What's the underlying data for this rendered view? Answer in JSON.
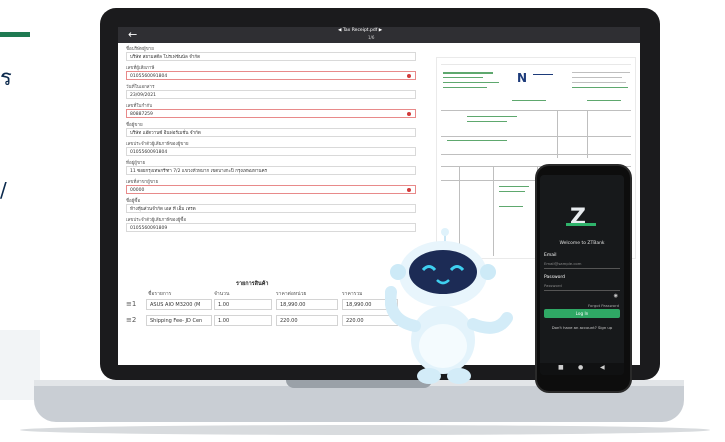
{
  "hero": {
    "accent_color": "#1f7a52",
    "clipped_glyph_1": "ร",
    "clipped_glyph_2": "/"
  },
  "app": {
    "doc_title": "Tax Receipt.pdf",
    "doc_pages": "1/6",
    "fields": [
      {
        "label": "ชื่อบริษัทผู้ขาย",
        "value": "บริษัท สยามสตีล โปรเฟชันนัล จำกัด",
        "error": false
      },
      {
        "label": "เลขที่ผู้เสียภาษี",
        "value": "0105560091804",
        "error": true
      },
      {
        "label": "วันที่ในเอกสาร",
        "value": "23/09/2021",
        "error": false
      },
      {
        "label": "เลขที่ใบกำกับ",
        "value": "80887259",
        "error": true
      },
      {
        "label": "ชื่อผู้ขาย",
        "value": "บริษัท แอ๊ดวานซ์ อินฟอร์เมชั่น จำกัด",
        "error": false
      },
      {
        "label": "เลขประจำตัวผู้เสียภาษีของผู้ขาย",
        "value": "0105560091804",
        "error": false
      },
      {
        "label": "ที่อยู่ผู้ขาย",
        "value": "11 ซอยกรุงเทพกรีฑา 7/2 แขวงหัวหมาก เขตบางกะปิ กรุงเทพมหานคร",
        "error": false
      },
      {
        "label": "เลขที่สาขาผู้ขาย",
        "value": "00000",
        "error": true
      },
      {
        "label": "ชื่อผู้ซื้อ",
        "value": "ห้างหุ้นส่วนจำกัด เอส ที เอ็ม เทรด",
        "error": false
      },
      {
        "label": "เลขประจำตัวผู้เสียภาษีของผู้ซื้อ",
        "value": "0105560091809",
        "error": false
      }
    ],
    "items_title": "รายการสินค้า",
    "table_headers": [
      "ชื่อรายการ",
      "จำนวน",
      "ราคาต่อหน่วย",
      "ราคารวม"
    ],
    "rows": [
      {
        "index": "1",
        "name": "ASUS AIO M3200 (M",
        "qty": "1.00",
        "unit_price": "18,990.00",
        "total": "18,990.00"
      },
      {
        "index": "2",
        "name": "Shipping Fee- JD Cen",
        "qty": "1.00",
        "unit_price": "220.00",
        "total": "220.00"
      }
    ],
    "icons": {
      "back": "back-arrow-icon",
      "prev": "prev-page-icon",
      "next": "next-page-icon",
      "error": "error-dot-icon"
    }
  },
  "phone": {
    "welcome": "Welcome to ZTBank",
    "email_label": "Email",
    "email_placeholder": "Email@sample.com",
    "password_label": "Password",
    "password_placeholder": "Password",
    "forgot": "Forgot Password",
    "login_button": "Log In",
    "signup_text": "Don't have an account? Sign up",
    "brand_color": "#2fa865"
  }
}
